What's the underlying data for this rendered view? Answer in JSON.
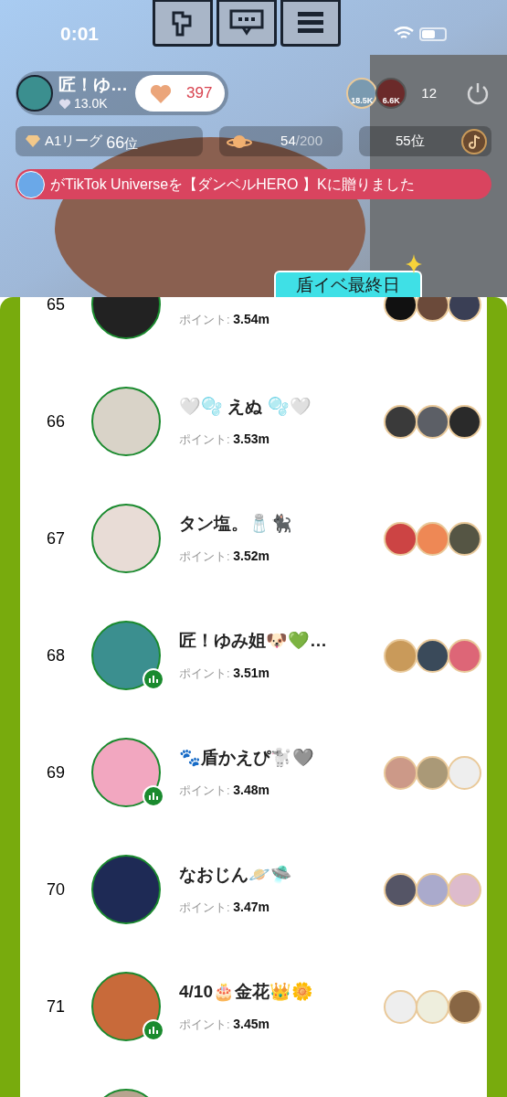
{
  "status_bar": {
    "time": "0:01"
  },
  "host": {
    "name": "匠！ゆ…",
    "likes": "13.0K",
    "hearts": "397"
  },
  "viewers": {
    "badges": [
      "18.5K",
      "6.6K"
    ],
    "count": "12"
  },
  "league": {
    "label": "A1リーグ",
    "rank": "66",
    "suffix": "位"
  },
  "planet": {
    "current": "54",
    "total": "/200"
  },
  "rank": {
    "label": "55位"
  },
  "gift_banner": {
    "text": "がTikTok Universeを【ダンベルHERO 】Kに贈りました"
  },
  "event_tag": {
    "text": "盾イベ最終日"
  },
  "rows": [
    {
      "rank": "65",
      "points_label": "ポイント:",
      "points": "3.54m",
      "live": false
    },
    {
      "rank": "66",
      "name": "🤍🫧 えぬ 🫧🤍",
      "points_label": "ポイント:",
      "points": "3.53m",
      "live": false
    },
    {
      "rank": "67",
      "name": "タン塩。🧂🐈‍⬛",
      "points_label": "ポイント:",
      "points": "3.52m",
      "live": false
    },
    {
      "rank": "68",
      "name": "匠！ゆみ姐🐶💚…",
      "points_label": "ポイント:",
      "points": "3.51m",
      "live": true
    },
    {
      "rank": "69",
      "name": "🐾盾かえぴ🐩🩶",
      "points_label": "ポイント:",
      "points": "3.48m",
      "live": true
    },
    {
      "rank": "70",
      "name": "なおじん🪐🛸",
      "points_label": "ポイント:",
      "points": "3.47m",
      "live": false
    },
    {
      "rank": "71",
      "name": "4/10🎂金花👑🌼",
      "points_label": "ポイント:",
      "points": "3.45m",
      "live": true
    },
    {
      "live": false
    }
  ]
}
